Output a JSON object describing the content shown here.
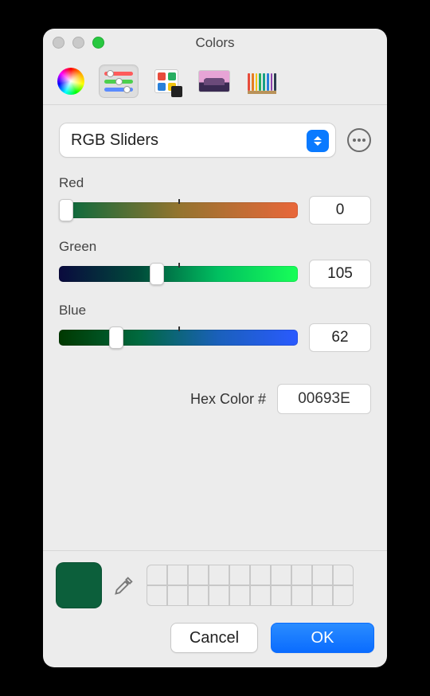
{
  "window": {
    "title": "Colors"
  },
  "toolbar": {
    "items": [
      "wheel",
      "sliders",
      "palettes",
      "image",
      "pencils"
    ],
    "selected": "sliders"
  },
  "mode": {
    "label": "RGB Sliders"
  },
  "sliders": {
    "red": {
      "label": "Red",
      "value": "0",
      "pos": 0
    },
    "green": {
      "label": "Green",
      "value": "105",
      "pos": 41
    },
    "blue": {
      "label": "Blue",
      "value": "62",
      "pos": 24
    }
  },
  "hex": {
    "label": "Hex Color #",
    "value": "00693E"
  },
  "current_color": "#0c5f3b",
  "swatch_count": 20,
  "buttons": {
    "cancel": "Cancel",
    "ok": "OK"
  }
}
